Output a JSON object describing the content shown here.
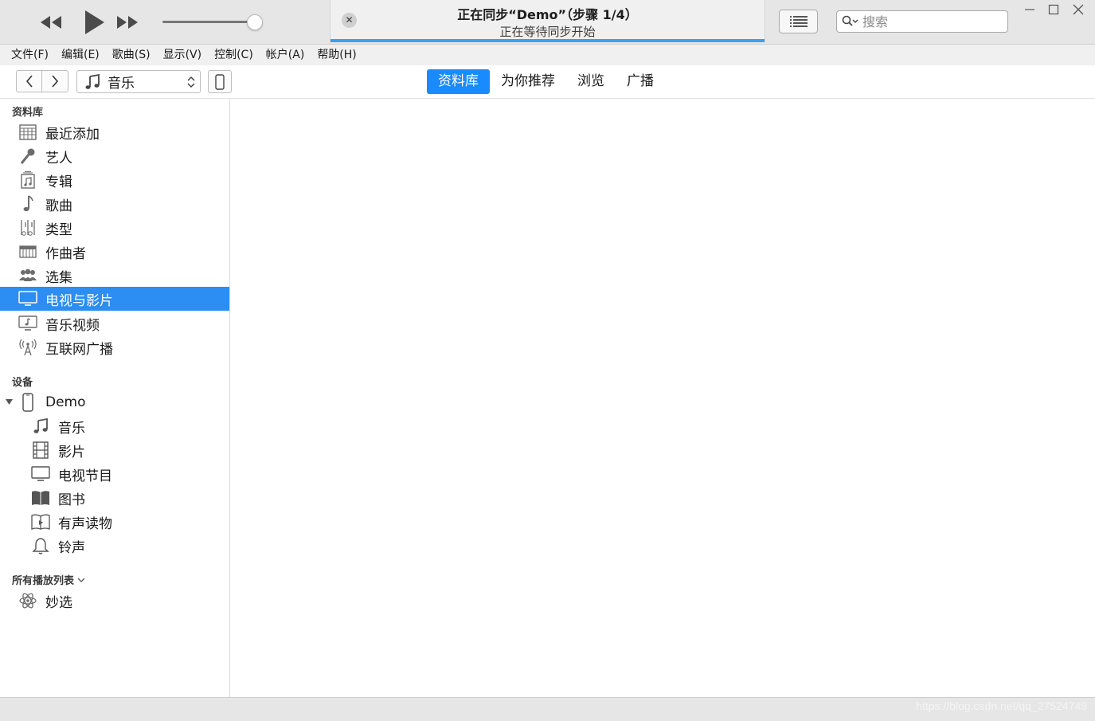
{
  "sync": {
    "title": "正在同步“Demo”（步骤 1/4）",
    "subtitle": "正在等待同步开始",
    "close_symbol": "✕",
    "progress": 1.0
  },
  "search": {
    "placeholder": "搜索",
    "value": ""
  },
  "menu": [
    "文件(F)",
    "编辑(E)",
    "歌曲(S)",
    "显示(V)",
    "控制(C)",
    "帐户(A)",
    "帮助(H)"
  ],
  "media_kind": {
    "selected": "音乐"
  },
  "tabs": [
    {
      "label": "资料库",
      "active": true
    },
    {
      "label": "为你推荐",
      "active": false
    },
    {
      "label": "浏览",
      "active": false
    },
    {
      "label": "广播",
      "active": false
    }
  ],
  "sidebar": {
    "library_header": "资料库",
    "library_items": [
      {
        "label": "最近添加",
        "icon": "recently-added-icon"
      },
      {
        "label": "艺人",
        "icon": "microphone-icon"
      },
      {
        "label": "专辑",
        "icon": "album-icon"
      },
      {
        "label": "歌曲",
        "icon": "music-note-icon"
      },
      {
        "label": "类型",
        "icon": "genre-icon"
      },
      {
        "label": "作曲者",
        "icon": "piano-icon"
      },
      {
        "label": "选集",
        "icon": "compilation-icon"
      },
      {
        "label": "电视与影片",
        "icon": "tv-icon",
        "selected": true
      },
      {
        "label": "音乐视频",
        "icon": "music-video-icon"
      },
      {
        "label": "互联网广播",
        "icon": "radio-antenna-icon"
      }
    ],
    "devices_header": "设备",
    "device": {
      "name": "Demo",
      "expanded": true
    },
    "device_items": [
      {
        "label": "音乐",
        "icon": "music-icon"
      },
      {
        "label": "影片",
        "icon": "film-icon"
      },
      {
        "label": "电视节目",
        "icon": "tv-show-icon"
      },
      {
        "label": "图书",
        "icon": "book-icon"
      },
      {
        "label": "有声读物",
        "icon": "audiobook-icon"
      },
      {
        "label": "铃声",
        "icon": "bell-icon"
      }
    ],
    "playlists_header": "所有播放列表",
    "playlists": [
      {
        "label": "妙选",
        "icon": "genius-atom-icon"
      }
    ]
  },
  "status": {
    "watermark": "https://blog.csdn.net/qq_27524749"
  },
  "colors": {
    "accent": "#1a8bff",
    "selection": "#2c8df3",
    "progress": "#3aa0f2"
  }
}
